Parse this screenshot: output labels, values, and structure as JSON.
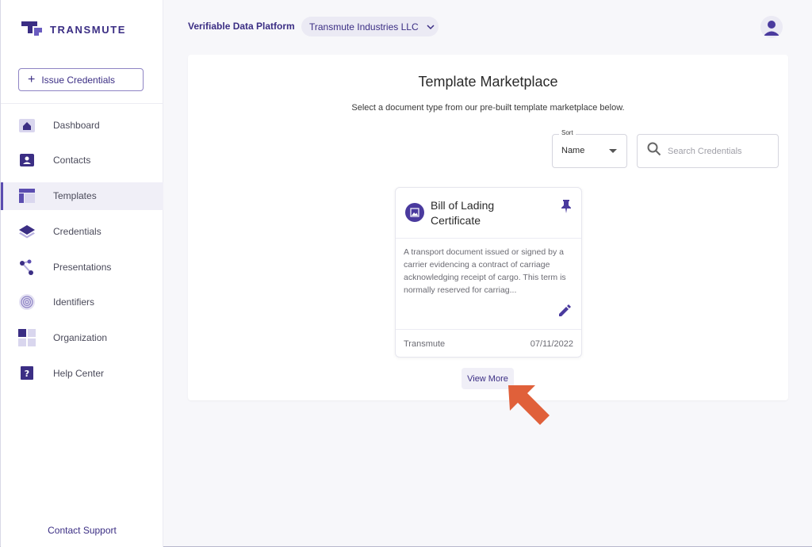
{
  "sidebar": {
    "logo_text": "TRANSMUTE",
    "issue_button": "Issue Credentials",
    "items": [
      {
        "label": "Dashboard",
        "icon": "home-icon"
      },
      {
        "label": "Contacts",
        "icon": "contact-card-icon"
      },
      {
        "label": "Templates",
        "icon": "template-icon",
        "active": true
      },
      {
        "label": "Credentials",
        "icon": "layers-icon"
      },
      {
        "label": "Presentations",
        "icon": "nodes-icon"
      },
      {
        "label": "Identifiers",
        "icon": "fingerprint-icon"
      },
      {
        "label": "Organization",
        "icon": "grid-icon"
      },
      {
        "label": "Help Center",
        "icon": "help-icon"
      }
    ],
    "contact_support": "Contact Support"
  },
  "header": {
    "platform": "Verifiable Data Platform",
    "org": "Transmute Industries LLC"
  },
  "main": {
    "title": "Template Marketplace",
    "subtitle": "Select a document type from our pre-built template marketplace below.",
    "sort": {
      "label": "Sort",
      "value": "Name"
    },
    "search": {
      "placeholder": "Search Credentials"
    },
    "card": {
      "title": "Bill of Lading Certificate",
      "description": "A transport document issued or signed by a carrier evidencing a contract of carriage acknowledging receipt of cargo. This term is normally reserved for carriag...",
      "author": "Transmute",
      "date": "07/11/2022"
    },
    "view_more": "View More"
  },
  "colors": {
    "accent": "#3b2e84",
    "accent_light": "#ebeaf4",
    "pointer_arrow": "#e0603a"
  }
}
